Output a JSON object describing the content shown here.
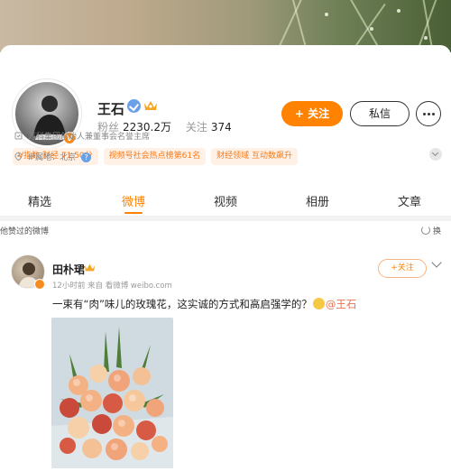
{
  "profile": {
    "name": "王石",
    "fans_label": "粉丝",
    "fans_value": "2230.2万",
    "following_label": "关注",
    "following_value": "374",
    "follow_button": "+ 关注",
    "message_button": "私信",
    "tags": [
      "V指数 财经 71.50分",
      "视频号社会热点榜第61名",
      "财经领域 互动数飙升"
    ],
    "bio": "万科集团创始人兼董事会名誉主席",
    "ip_location": "IP属地：北京"
  },
  "tabs": [
    "精选",
    "微博",
    "视频",
    "相册",
    "文章"
  ],
  "active_tab": "微博",
  "liked_bar": {
    "label": "他赞过的微博",
    "refresh": "换"
  },
  "post": {
    "author": "田朴珺",
    "meta": "12小时前 来自 看微博 weibo.com",
    "follow_button": "+关注",
    "text": "一束有“肉”味儿的玫瑰花，这实诚的方式和高启强学的？",
    "mention": "@王石"
  },
  "colors": {
    "accent": "#ff8200",
    "tag_bg": "#fff1e6",
    "tag_text": "#f77a1a",
    "verify": "#6aa0e8",
    "mention": "#eb7350"
  }
}
